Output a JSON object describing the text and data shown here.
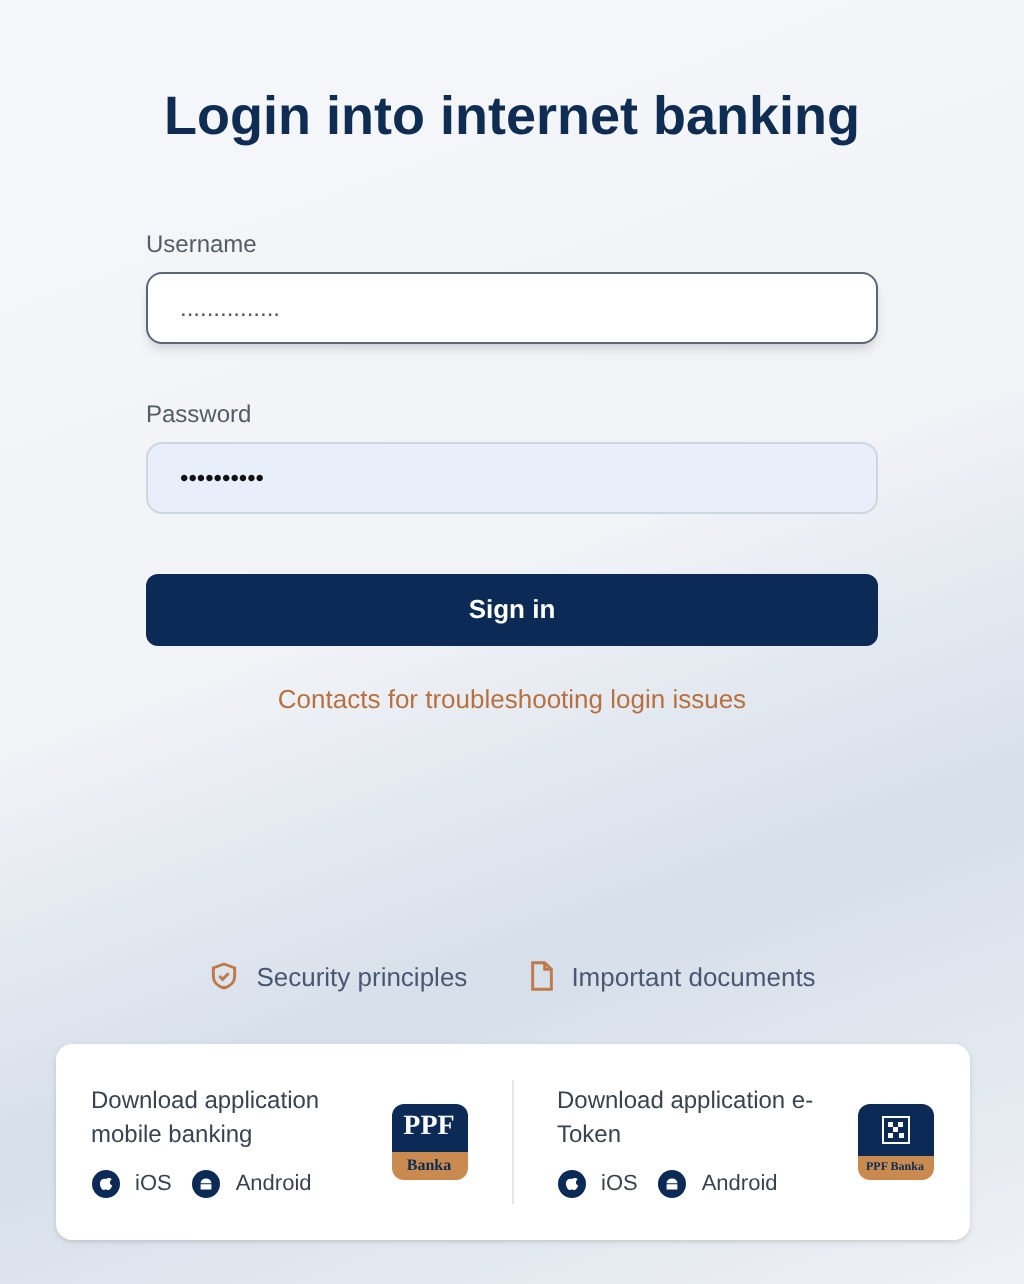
{
  "title": "Login into internet banking",
  "fields": [
    {
      "label": "Username",
      "value": "...............",
      "focused": true
    },
    {
      "label": "Password",
      "value": "••••••••••",
      "focused": false
    }
  ],
  "sign_in": "Sign in",
  "help_link": "Contacts for troubleshooting login issues",
  "links": [
    {
      "kind": "shield",
      "label": "Security principles"
    },
    {
      "kind": "document",
      "label": "Important documents"
    }
  ],
  "apps": [
    {
      "kind": "banking",
      "title": "Download application mobile banking",
      "logo_top": "PPF",
      "logo_bottom": "Banka",
      "stores": [
        "iOS",
        "Android"
      ]
    },
    {
      "kind": "token",
      "title": "Download application e-Token",
      "logo_bottom": "PPF Banka",
      "stores": [
        "iOS",
        "Android"
      ]
    }
  ]
}
